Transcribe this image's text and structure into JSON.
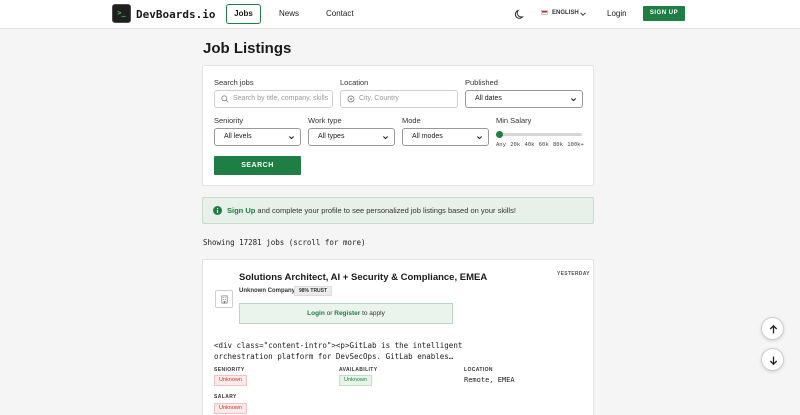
{
  "nav": {
    "logo_glyph": ">_",
    "brand": "DevBoards.io",
    "links": [
      {
        "label": "Jobs",
        "active": true
      },
      {
        "label": "News"
      },
      {
        "label": "Contact"
      }
    ],
    "theme_icon": "moon-icon",
    "language": "ENGLISH",
    "login": "Login",
    "signup": "SIGN UP"
  },
  "page_title": "Job Listings",
  "filters": {
    "search_label": "Search jobs",
    "search_placeholder": "Search by title, company, skills",
    "location_label": "Location",
    "location_placeholder": "City, Country",
    "published_label": "Published",
    "published_value": "All dates",
    "seniority_label": "Seniority",
    "seniority_value": "All levels",
    "worktype_label": "Work type",
    "worktype_value": "All types",
    "mode_label": "Mode",
    "mode_value": "All modes",
    "salary_label": "Min Salary",
    "salary_ticks": "Any 20k 40k 60k 80k 100k+",
    "salary_value": "Any",
    "search_button": "SEARCH"
  },
  "banner": {
    "link": "Sign Up",
    "text": " and complete your profile to see personalized job listings based on your skills!"
  },
  "showing": "Showing 17281 jobs (scroll for more)",
  "job": {
    "title": "Solutions Architect, AI + Security & Compliance, EMEA",
    "posted": "YESTERDAY",
    "company": "Unknown Company",
    "trust": "98% TRUST",
    "login_prefix": "Login",
    "login_or": " or ",
    "login_register": "Register",
    "login_suffix": " to apply",
    "description": "<div class=\"content-intro\"><p>GitLab is the intelligent orchestration platform for DevSecOps. GitLab enables…",
    "seniority_label": "SENIORITY",
    "seniority_value": "Unknown",
    "availability_label": "AVAILABILITY",
    "availability_value": "Unknown",
    "location_label": "LOCATION",
    "location_value": "Remote, EMEA",
    "salary_label": "SALARY",
    "salary_value": "Unknown"
  },
  "colors": {
    "brand_green": "#1e7e43",
    "banner_bg": "#e7f0e9",
    "badge_red": "#c0392b"
  }
}
